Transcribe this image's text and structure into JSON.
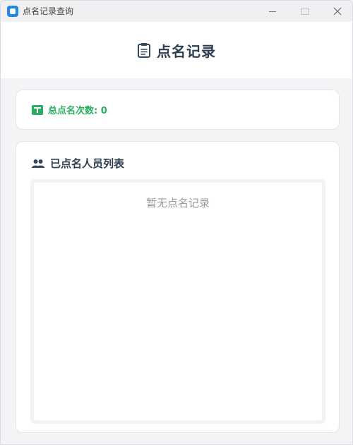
{
  "window": {
    "title": "点名记录查询"
  },
  "header": {
    "title": "点名记录",
    "icon": "clipboard-icon"
  },
  "summary": {
    "label": "总点名次数: 0",
    "icon": "tally-icon",
    "color": "#27ae60"
  },
  "roster": {
    "title": "已点名人员列表",
    "icon": "people-icon",
    "empty_text": "暂无点名记录"
  }
}
